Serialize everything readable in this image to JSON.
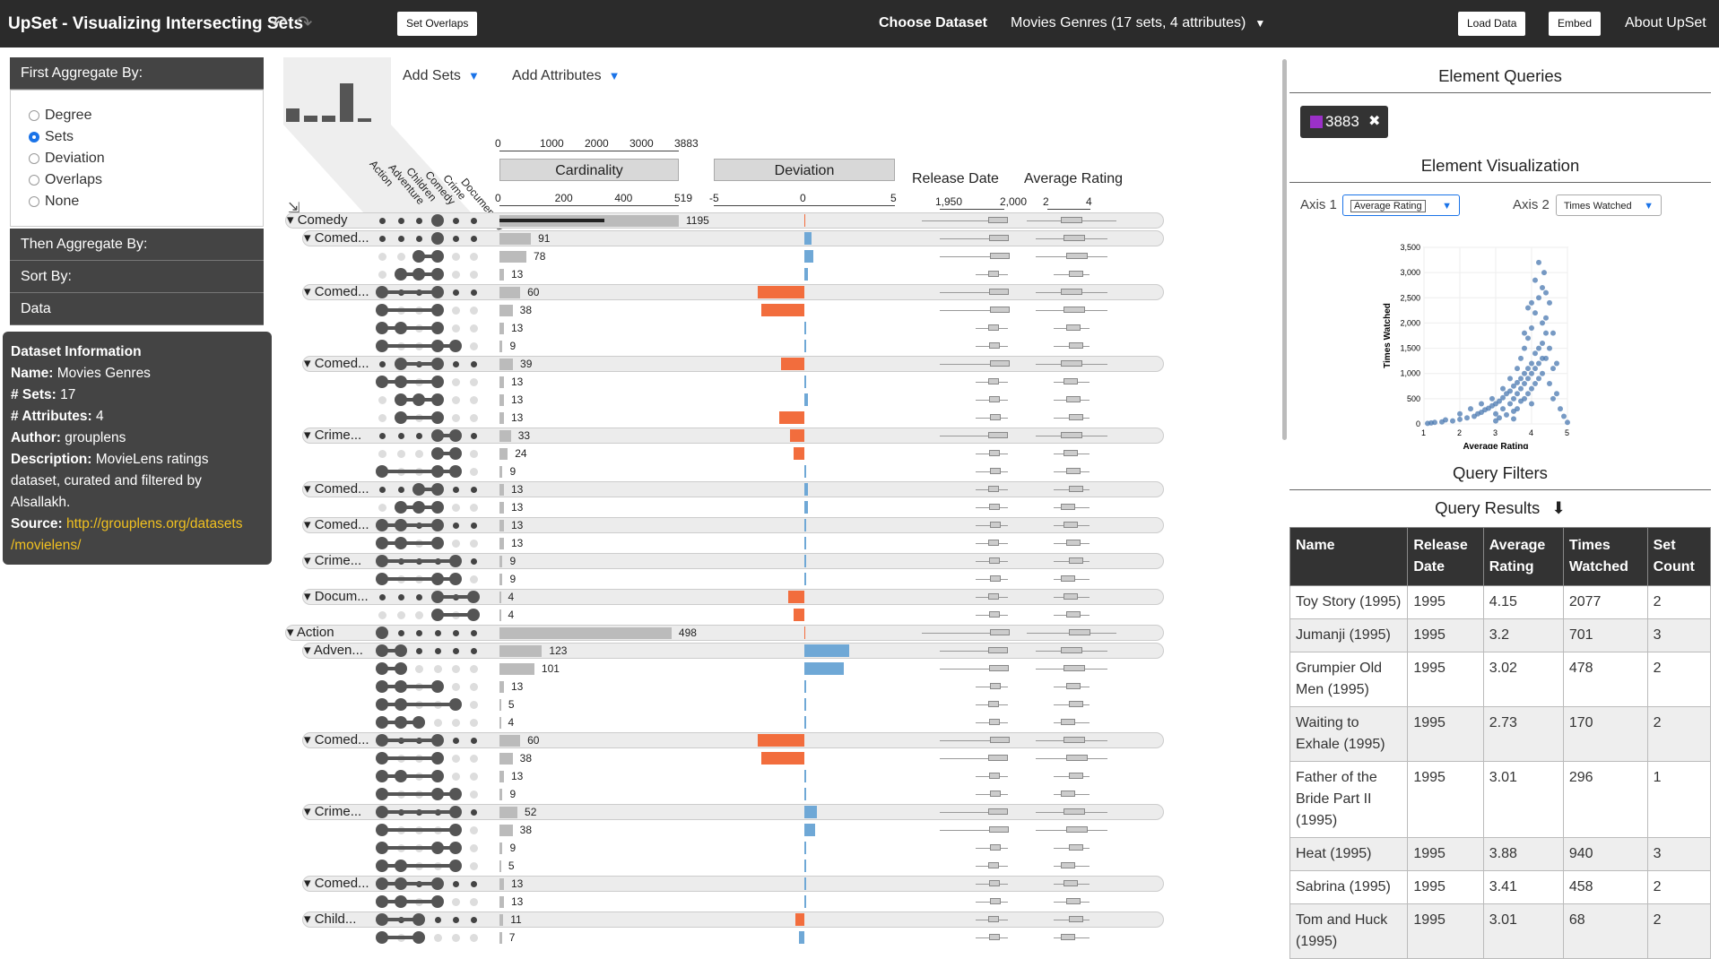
{
  "app_title": "UpSet - Visualizing Intersecting Sets",
  "toolbar": {
    "undo_icon": "undo-icon",
    "redo_icon": "redo-icon",
    "set_overlaps": "Set Overlaps",
    "choose_dataset": "Choose Dataset",
    "dataset_select": "Movies Genres (17 sets, 4 attributes)",
    "load_data": "Load Data",
    "embed": "Embed",
    "about": "About UpSet"
  },
  "left_panel": {
    "first_aggregate": "First Aggregate By:",
    "options": [
      "Degree",
      "Sets",
      "Deviation",
      "Overlaps",
      "None"
    ],
    "selected_index": 1,
    "then_aggregate": "Then Aggregate By:",
    "sort_by": "Sort By:",
    "data": "Data"
  },
  "dataset_info": {
    "heading": "Dataset Information",
    "name_label": "Name:",
    "name": "Movies Genres",
    "sets_label": "# Sets:",
    "sets": "17",
    "attr_label": "# Attributes:",
    "attributes": "4",
    "author_label": "Author:",
    "author": "grouplens",
    "desc_label": "Description:",
    "desc_1": "MovieLens ratings",
    "desc_2": "dataset, curated and filtered by",
    "desc_3": "Alsallakh.",
    "source_label": "Source:",
    "source_1": "http://grouplens.org/datasets",
    "source_2": "/movielens/"
  },
  "matrix": {
    "add_sets": "Add Sets",
    "add_attributes": "Add Attributes",
    "collapse_icon": "collapse-icon",
    "histogram": [
      0.22,
      0.1,
      0.1,
      0.62,
      0.06
    ],
    "set_names": [
      "Action",
      "Adventure",
      "Children",
      "Comedy",
      "Crime",
      "Documentary"
    ],
    "cardinality_title": "Cardinality",
    "cardinality_top_ticks": [
      "0",
      "1000",
      "2000",
      "3000",
      "3883"
    ],
    "cardinality_ticks": [
      "0",
      "200",
      "400",
      "519"
    ],
    "deviation_title": "Deviation",
    "deviation_ticks": [
      "-5",
      "0",
      "5"
    ],
    "release_title": "Release Date",
    "release_ticks": [
      "1,950",
      "2,000"
    ],
    "rating_title": "Average Rating",
    "rating_ticks": [
      "2",
      "4"
    ]
  },
  "rows": [
    {
      "level": 0,
      "label": "Comedy",
      "size": 1195,
      "count": "1195",
      "dev": 0,
      "dots": [
        0,
        0,
        0,
        1,
        0,
        0
      ]
    },
    {
      "level": 1,
      "label": "Comed...",
      "size": 91,
      "count": "91",
      "dev": 0.4,
      "dots": [
        0,
        0,
        0,
        1,
        0,
        0
      ]
    },
    {
      "level": 2,
      "size": 78,
      "count": "78",
      "dev": 0.5,
      "dots": [
        0,
        0,
        1,
        1,
        0,
        0
      ]
    },
    {
      "level": 2,
      "size": 13,
      "count": "13",
      "dev": 0.2,
      "dots": [
        0,
        1,
        1,
        1,
        0,
        0
      ]
    },
    {
      "level": 1,
      "label": "Comed...",
      "size": 60,
      "count": "60",
      "dev": -2.6,
      "dots": [
        1,
        0,
        0,
        1,
        0,
        0
      ]
    },
    {
      "level": 2,
      "size": 38,
      "count": "38",
      "dev": -2.4,
      "dots": [
        1,
        0,
        0,
        1,
        0,
        0
      ]
    },
    {
      "level": 2,
      "size": 13,
      "count": "13",
      "dev": 0.1,
      "dots": [
        1,
        1,
        0,
        1,
        0,
        0
      ]
    },
    {
      "level": 2,
      "size": 9,
      "count": "9",
      "dev": 0.1,
      "dots": [
        1,
        0,
        0,
        1,
        1,
        0
      ]
    },
    {
      "level": 1,
      "label": "Comed...",
      "size": 39,
      "count": "39",
      "dev": -1.3,
      "dots": [
        0,
        1,
        0,
        1,
        0,
        0
      ]
    },
    {
      "level": 2,
      "size": 13,
      "count": "13",
      "dev": 0.1,
      "dots": [
        1,
        1,
        0,
        1,
        0,
        0
      ]
    },
    {
      "level": 2,
      "size": 13,
      "count": "13",
      "dev": 0.2,
      "dots": [
        0,
        1,
        1,
        1,
        0,
        0
      ]
    },
    {
      "level": 2,
      "size": 13,
      "count": "13",
      "dev": -1.4,
      "dots": [
        0,
        1,
        0,
        1,
        0,
        0
      ]
    },
    {
      "level": 1,
      "label": "Crime...",
      "size": 33,
      "count": "33",
      "dev": -0.8,
      "dots": [
        0,
        0,
        0,
        1,
        1,
        0
      ]
    },
    {
      "level": 2,
      "size": 24,
      "count": "24",
      "dev": -0.6,
      "dots": [
        0,
        0,
        0,
        1,
        1,
        0
      ]
    },
    {
      "level": 2,
      "size": 9,
      "count": "9",
      "dev": 0.1,
      "dots": [
        1,
        0,
        0,
        1,
        1,
        0
      ]
    },
    {
      "level": 1,
      "label": "Comed...",
      "size": 13,
      "count": "13",
      "dev": 0.2,
      "dots": [
        0,
        0,
        1,
        1,
        0,
        0
      ]
    },
    {
      "level": 2,
      "size": 13,
      "count": "13",
      "dev": 0.2,
      "dots": [
        0,
        1,
        1,
        1,
        0,
        0
      ]
    },
    {
      "level": 1,
      "label": "Comed...",
      "size": 13,
      "count": "13",
      "dev": 0.1,
      "dots": [
        1,
        1,
        0,
        1,
        0,
        0
      ]
    },
    {
      "level": 2,
      "size": 13,
      "count": "13",
      "dev": 0.1,
      "dots": [
        1,
        1,
        0,
        1,
        0,
        0
      ]
    },
    {
      "level": 1,
      "label": "Crime...",
      "size": 9,
      "count": "9",
      "dev": 0.1,
      "dots": [
        1,
        0,
        0,
        0,
        1,
        0
      ]
    },
    {
      "level": 2,
      "size": 9,
      "count": "9",
      "dev": 0.1,
      "dots": [
        1,
        0,
        0,
        1,
        1,
        0
      ]
    },
    {
      "level": 1,
      "label": "Docum...",
      "size": 4,
      "count": "4",
      "dev": -0.9,
      "dots": [
        0,
        0,
        0,
        1,
        0,
        1
      ]
    },
    {
      "level": 2,
      "size": 4,
      "count": "4",
      "dev": -0.6,
      "dots": [
        0,
        0,
        0,
        1,
        0,
        1
      ]
    },
    {
      "level": 0,
      "label": "Action",
      "size": 498,
      "count": "498",
      "dev": 0,
      "dots": [
        1,
        0,
        0,
        0,
        0,
        0
      ]
    },
    {
      "level": 1,
      "label": "Adven...",
      "size": 123,
      "count": "123",
      "dev": 2.5,
      "dots": [
        1,
        1,
        0,
        0,
        0,
        0
      ]
    },
    {
      "level": 2,
      "size": 101,
      "count": "101",
      "dev": 2.2,
      "dots": [
        1,
        1,
        0,
        0,
        0,
        0
      ]
    },
    {
      "level": 2,
      "size": 13,
      "count": "13",
      "dev": 0.1,
      "dots": [
        1,
        1,
        0,
        1,
        0,
        0
      ]
    },
    {
      "level": 2,
      "size": 5,
      "count": "5",
      "dev": 0.1,
      "dots": [
        1,
        1,
        0,
        0,
        1,
        0
      ]
    },
    {
      "level": 2,
      "size": 4,
      "count": "4",
      "dev": 0.1,
      "dots": [
        1,
        1,
        1,
        0,
        0,
        0
      ]
    },
    {
      "level": 1,
      "label": "Comed...",
      "size": 60,
      "count": "60",
      "dev": -2.6,
      "dots": [
        1,
        0,
        0,
        1,
        0,
        0
      ]
    },
    {
      "level": 2,
      "size": 38,
      "count": "38",
      "dev": -2.4,
      "dots": [
        1,
        0,
        0,
        1,
        0,
        0
      ]
    },
    {
      "level": 2,
      "size": 13,
      "count": "13",
      "dev": 0.1,
      "dots": [
        1,
        1,
        0,
        1,
        0,
        0
      ]
    },
    {
      "level": 2,
      "size": 9,
      "count": "9",
      "dev": 0.1,
      "dots": [
        1,
        0,
        0,
        1,
        1,
        0
      ]
    },
    {
      "level": 1,
      "label": "Crime...",
      "size": 52,
      "count": "52",
      "dev": 0.7,
      "dots": [
        1,
        0,
        0,
        0,
        1,
        0
      ]
    },
    {
      "level": 2,
      "size": 38,
      "count": "38",
      "dev": 0.6,
      "dots": [
        1,
        0,
        0,
        0,
        1,
        0
      ]
    },
    {
      "level": 2,
      "size": 9,
      "count": "9",
      "dev": 0.1,
      "dots": [
        1,
        0,
        0,
        1,
        1,
        0
      ]
    },
    {
      "level": 2,
      "size": 5,
      "count": "5",
      "dev": 0.1,
      "dots": [
        1,
        1,
        0,
        0,
        1,
        0
      ]
    },
    {
      "level": 1,
      "label": "Comed...",
      "size": 13,
      "count": "13",
      "dev": 0.1,
      "dots": [
        1,
        1,
        0,
        1,
        0,
        0
      ]
    },
    {
      "level": 2,
      "size": 13,
      "count": "13",
      "dev": 0.1,
      "dots": [
        1,
        1,
        0,
        1,
        0,
        0
      ]
    },
    {
      "level": 1,
      "label": "Child...",
      "size": 11,
      "count": "11",
      "dev": -0.5,
      "dots": [
        1,
        0,
        1,
        0,
        0,
        0
      ]
    },
    {
      "level": 2,
      "size": 7,
      "count": "7",
      "dev": -0.3,
      "dots": [
        1,
        0,
        1,
        0,
        0,
        0
      ]
    }
  ],
  "right_panel": {
    "element_queries": "Element Queries",
    "query_count": "3883",
    "element_visualization": "Element Visualization",
    "axis1_label": "Axis 1",
    "axis1_value": "Average Rating",
    "axis2_label": "Axis 2",
    "axis2_value": "Times Watched",
    "query_filters": "Query Filters",
    "query_results": "Query Results",
    "download_icon": "download-icon",
    "columns": [
      "Name",
      "Release Date",
      "Average Rating",
      "Times Watched",
      "Set Count"
    ],
    "results": [
      [
        "Toy Story (1995)",
        "1995",
        "4.15",
        "2077",
        "2"
      ],
      [
        "Jumanji (1995)",
        "1995",
        "3.2",
        "701",
        "3"
      ],
      [
        "Grumpier Old Men (1995)",
        "1995",
        "3.02",
        "478",
        "2"
      ],
      [
        "Waiting to Exhale (1995)",
        "1995",
        "2.73",
        "170",
        "2"
      ],
      [
        "Father of the Bride Part II (1995)",
        "1995",
        "3.01",
        "296",
        "1"
      ],
      [
        "Heat (1995)",
        "1995",
        "3.88",
        "940",
        "3"
      ],
      [
        "Sabrina (1995)",
        "1995",
        "3.41",
        "458",
        "2"
      ],
      [
        "Tom and Huck (1995)",
        "1995",
        "3.01",
        "68",
        "2"
      ]
    ]
  },
  "chart_data": {
    "type": "scatter",
    "xlabel": "Average Rating",
    "ylabel": "Times Watched",
    "xlim": [
      1,
      5
    ],
    "ylim": [
      0,
      3500
    ],
    "x_ticks": [
      "1",
      "2",
      "3",
      "4",
      "5"
    ],
    "y_ticks": [
      "0",
      "500",
      "1,000",
      "1,500",
      "2,000",
      "2,500",
      "3,000",
      "3,500"
    ],
    "point_color": "#4a78b0",
    "points": [
      [
        1.2,
        20
      ],
      [
        1.5,
        40
      ],
      [
        1.8,
        60
      ],
      [
        2.0,
        90
      ],
      [
        2.2,
        120
      ],
      [
        2.4,
        150
      ],
      [
        2.5,
        200
      ],
      [
        2.6,
        230
      ],
      [
        2.7,
        280
      ],
      [
        2.8,
        310
      ],
      [
        2.9,
        360
      ],
      [
        3.0,
        400
      ],
      [
        3.0,
        200
      ],
      [
        3.1,
        450
      ],
      [
        3.1,
        120
      ],
      [
        3.2,
        520
      ],
      [
        3.2,
        300
      ],
      [
        3.3,
        600
      ],
      [
        3.3,
        180
      ],
      [
        3.4,
        650
      ],
      [
        3.4,
        400
      ],
      [
        3.5,
        750
      ],
      [
        3.5,
        500
      ],
      [
        3.5,
        250
      ],
      [
        3.6,
        820
      ],
      [
        3.6,
        600
      ],
      [
        3.6,
        300
      ],
      [
        3.7,
        900
      ],
      [
        3.7,
        700
      ],
      [
        3.7,
        450
      ],
      [
        3.7,
        1300
      ],
      [
        3.8,
        1000
      ],
      [
        3.8,
        800
      ],
      [
        3.8,
        500
      ],
      [
        3.8,
        1500
      ],
      [
        3.9,
        1100
      ],
      [
        3.9,
        900
      ],
      [
        3.9,
        600
      ],
      [
        3.9,
        1700
      ],
      [
        4.0,
        1200
      ],
      [
        4.0,
        1000
      ],
      [
        4.0,
        700
      ],
      [
        4.0,
        1900
      ],
      [
        4.1,
        1400
      ],
      [
        4.1,
        1100
      ],
      [
        4.1,
        800
      ],
      [
        4.1,
        2200
      ],
      [
        4.2,
        1500
      ],
      [
        4.2,
        1200
      ],
      [
        4.2,
        2500
      ],
      [
        4.2,
        900
      ],
      [
        4.3,
        1600
      ],
      [
        4.3,
        2000
      ],
      [
        4.3,
        2700
      ],
      [
        4.3,
        1000
      ],
      [
        4.35,
        3000
      ],
      [
        4.4,
        1300
      ],
      [
        4.4,
        2100
      ],
      [
        4.4,
        2600
      ],
      [
        4.5,
        1500
      ],
      [
        4.5,
        2400
      ],
      [
        4.5,
        800
      ],
      [
        4.6,
        1100
      ],
      [
        4.6,
        500
      ],
      [
        4.7,
        600
      ],
      [
        4.8,
        300
      ],
      [
        4.9,
        150
      ],
      [
        5.0,
        30
      ],
      [
        3.9,
        2300
      ],
      [
        4.1,
        2850
      ],
      [
        4.2,
        3200
      ],
      [
        4.0,
        2400
      ],
      [
        3.6,
        1100
      ],
      [
        3.4,
        900
      ],
      [
        3.2,
        700
      ],
      [
        2.9,
        500
      ],
      [
        2.6,
        400
      ],
      [
        2.3,
        300
      ],
      [
        2.0,
        200
      ],
      [
        1.6,
        80
      ],
      [
        1.3,
        30
      ],
      [
        1.1,
        10
      ],
      [
        4.6,
        1800
      ],
      [
        4.4,
        1800
      ],
      [
        4.7,
        1200
      ],
      [
        3.8,
        1800
      ],
      [
        4.3,
        1300
      ],
      [
        4.0,
        400
      ],
      [
        3.5,
        100
      ],
      [
        3.0,
        60
      ]
    ]
  }
}
